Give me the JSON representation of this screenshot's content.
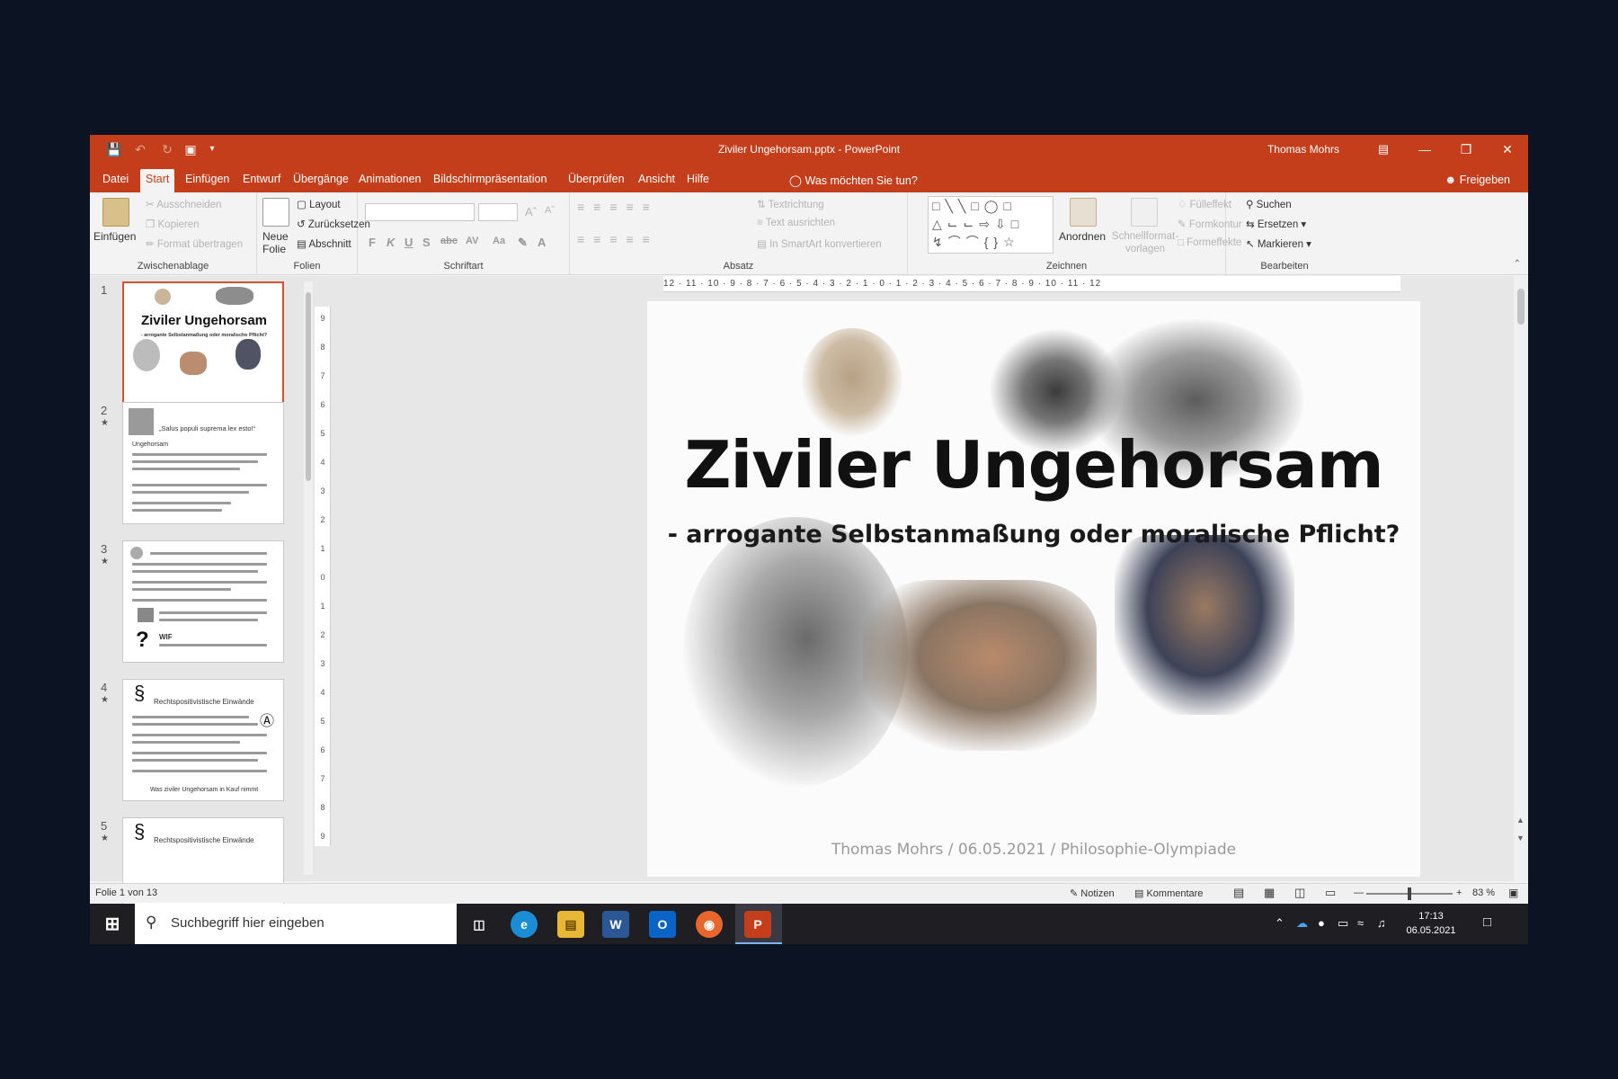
{
  "window": {
    "title": "Ziviler Ungehorsam.pptx - PowerPoint",
    "user": "Thomas Mohrs",
    "accent_color": "#c43e1c"
  },
  "tabs": [
    {
      "label": "Datei"
    },
    {
      "label": "Start"
    },
    {
      "label": "Einfügen"
    },
    {
      "label": "Entwurf"
    },
    {
      "label": "Übergänge"
    },
    {
      "label": "Animationen"
    },
    {
      "label": "Bildschirmpräsentation"
    },
    {
      "label": "Überprüfen"
    },
    {
      "label": "Ansicht"
    },
    {
      "label": "Hilfe"
    }
  ],
  "tell_me": "Was möchten Sie tun?",
  "share": "Freigeben",
  "ribbon": {
    "clipboard": {
      "label": "Zwischenablage",
      "paste": "Einfügen",
      "cut": "Ausschneiden",
      "copy": "Kopieren",
      "format_painter": "Format übertragen"
    },
    "slides": {
      "label": "Folien",
      "new_slide": "Neue Folie",
      "layout": "Layout",
      "reset": "Zurücksetzen",
      "section": "Abschnitt"
    },
    "font": {
      "label": "Schriftart"
    },
    "paragraph": {
      "label": "Absatz",
      "text_direction": "Textrichtung",
      "align_text": "Text ausrichten",
      "smartart": "In SmartArt konvertieren"
    },
    "drawing": {
      "label": "Zeichnen",
      "arrange": "Anordnen",
      "quick_styles": "Schnellformat-vorlagen",
      "fill": "Fülleffekt",
      "outline": "Formkontur",
      "effects": "Formeffekte"
    },
    "editing": {
      "label": "Bearbeiten",
      "find": "Suchen",
      "replace": "Ersetzen",
      "select": "Markieren"
    }
  },
  "thumbnails": [
    {
      "num": "1",
      "title": "Ziviler Ungehorsam",
      "subtitle": "- arrogante Selbstanmaßung oder moralische Pflicht?"
    },
    {
      "num": "2",
      "title": "„Salus populi suprema lex esto!“",
      "text": "Ungehorsam"
    },
    {
      "num": "3",
      "title": "",
      "text": "WIF"
    },
    {
      "num": "4",
      "title": "Rechtspositivistische Einwände",
      "text": "Was ziviler Ungehorsam in Kauf nimmt"
    },
    {
      "num": "5",
      "title": "Rechtspositivistische Einwände"
    }
  ],
  "slide": {
    "title": "Ziviler Ungehorsam",
    "subtitle": "- arrogante Selbstanmaßung oder moralische Pflicht?",
    "footer": "Thomas Mohrs / 06.05.2021 / Philosophie-Olympiade"
  },
  "ruler": {
    "h": "12 · 11 · 10 · 9 · 8 · 7 · 6 · 5 · 4 · 3 · 2 · 1 · 0 · 1 · 2 · 3 · 4 · 5 · 6 · 7 · 8 · 9 · 10 · 11 · 12",
    "v": [
      "9",
      "8",
      "7",
      "6",
      "5",
      "4",
      "3",
      "2",
      "1",
      "0",
      "1",
      "2",
      "3",
      "4",
      "5",
      "6",
      "7",
      "8",
      "9"
    ]
  },
  "status": {
    "slide_count": "Folie 1 von 13",
    "notes": "Notizen",
    "comments": "Kommentare",
    "zoom": "83 %",
    "zoom_level": 0.5
  },
  "taskbar": {
    "search_placeholder": "Suchbegriff hier eingeben",
    "time": "17:13",
    "date": "06.05.2021"
  }
}
